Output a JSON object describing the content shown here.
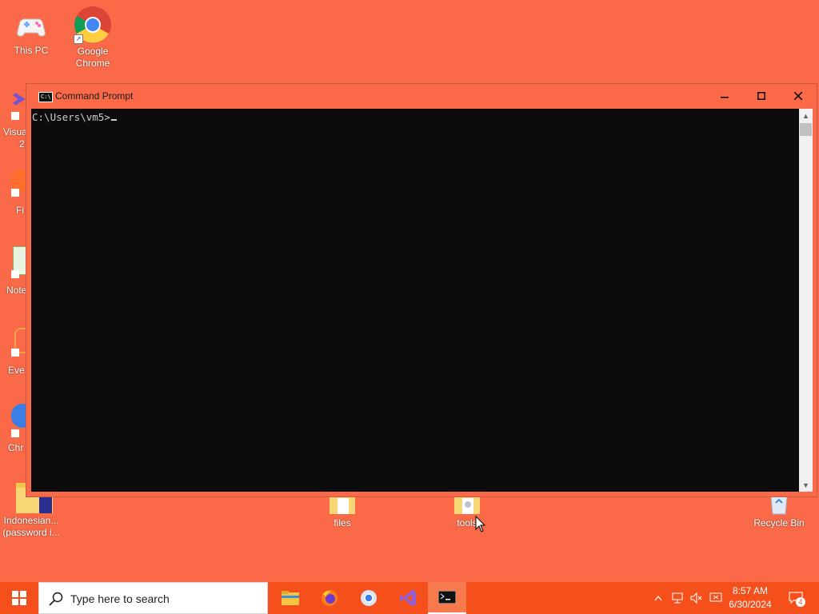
{
  "desktop": {
    "icons": [
      {
        "label": "This PC"
      },
      {
        "label": "Google Chrome"
      },
      {
        "label": "Indonesian... (password i..."
      },
      {
        "label": "files"
      },
      {
        "label": "tools"
      },
      {
        "label": "Recycle Bin"
      }
    ],
    "partial_labels": [
      "Visua",
      "2",
      "Fi",
      "Note",
      "Eve",
      "Chr"
    ]
  },
  "window": {
    "title": "Command Prompt",
    "icon_text": "C:\\",
    "buttons": {
      "minimize": "–",
      "maximize": "☐",
      "close": "✕"
    },
    "console_prompt": "C:\\Users\\vm5>"
  },
  "taskbar": {
    "search_placeholder": "Type here to search",
    "apps": [
      "file-explorer-icon",
      "firefox-icon",
      "chrome-icon",
      "visual-studio-icon",
      "command-prompt-icon"
    ],
    "clock": {
      "time": "8:57 AM",
      "date": "6/30/2024"
    },
    "notification_count": "4"
  },
  "colors": {
    "desktop_background": "#fa6a48",
    "taskbar": "#f5501c",
    "console_background": "#0c0c0c",
    "console_text": "#cccccc"
  }
}
